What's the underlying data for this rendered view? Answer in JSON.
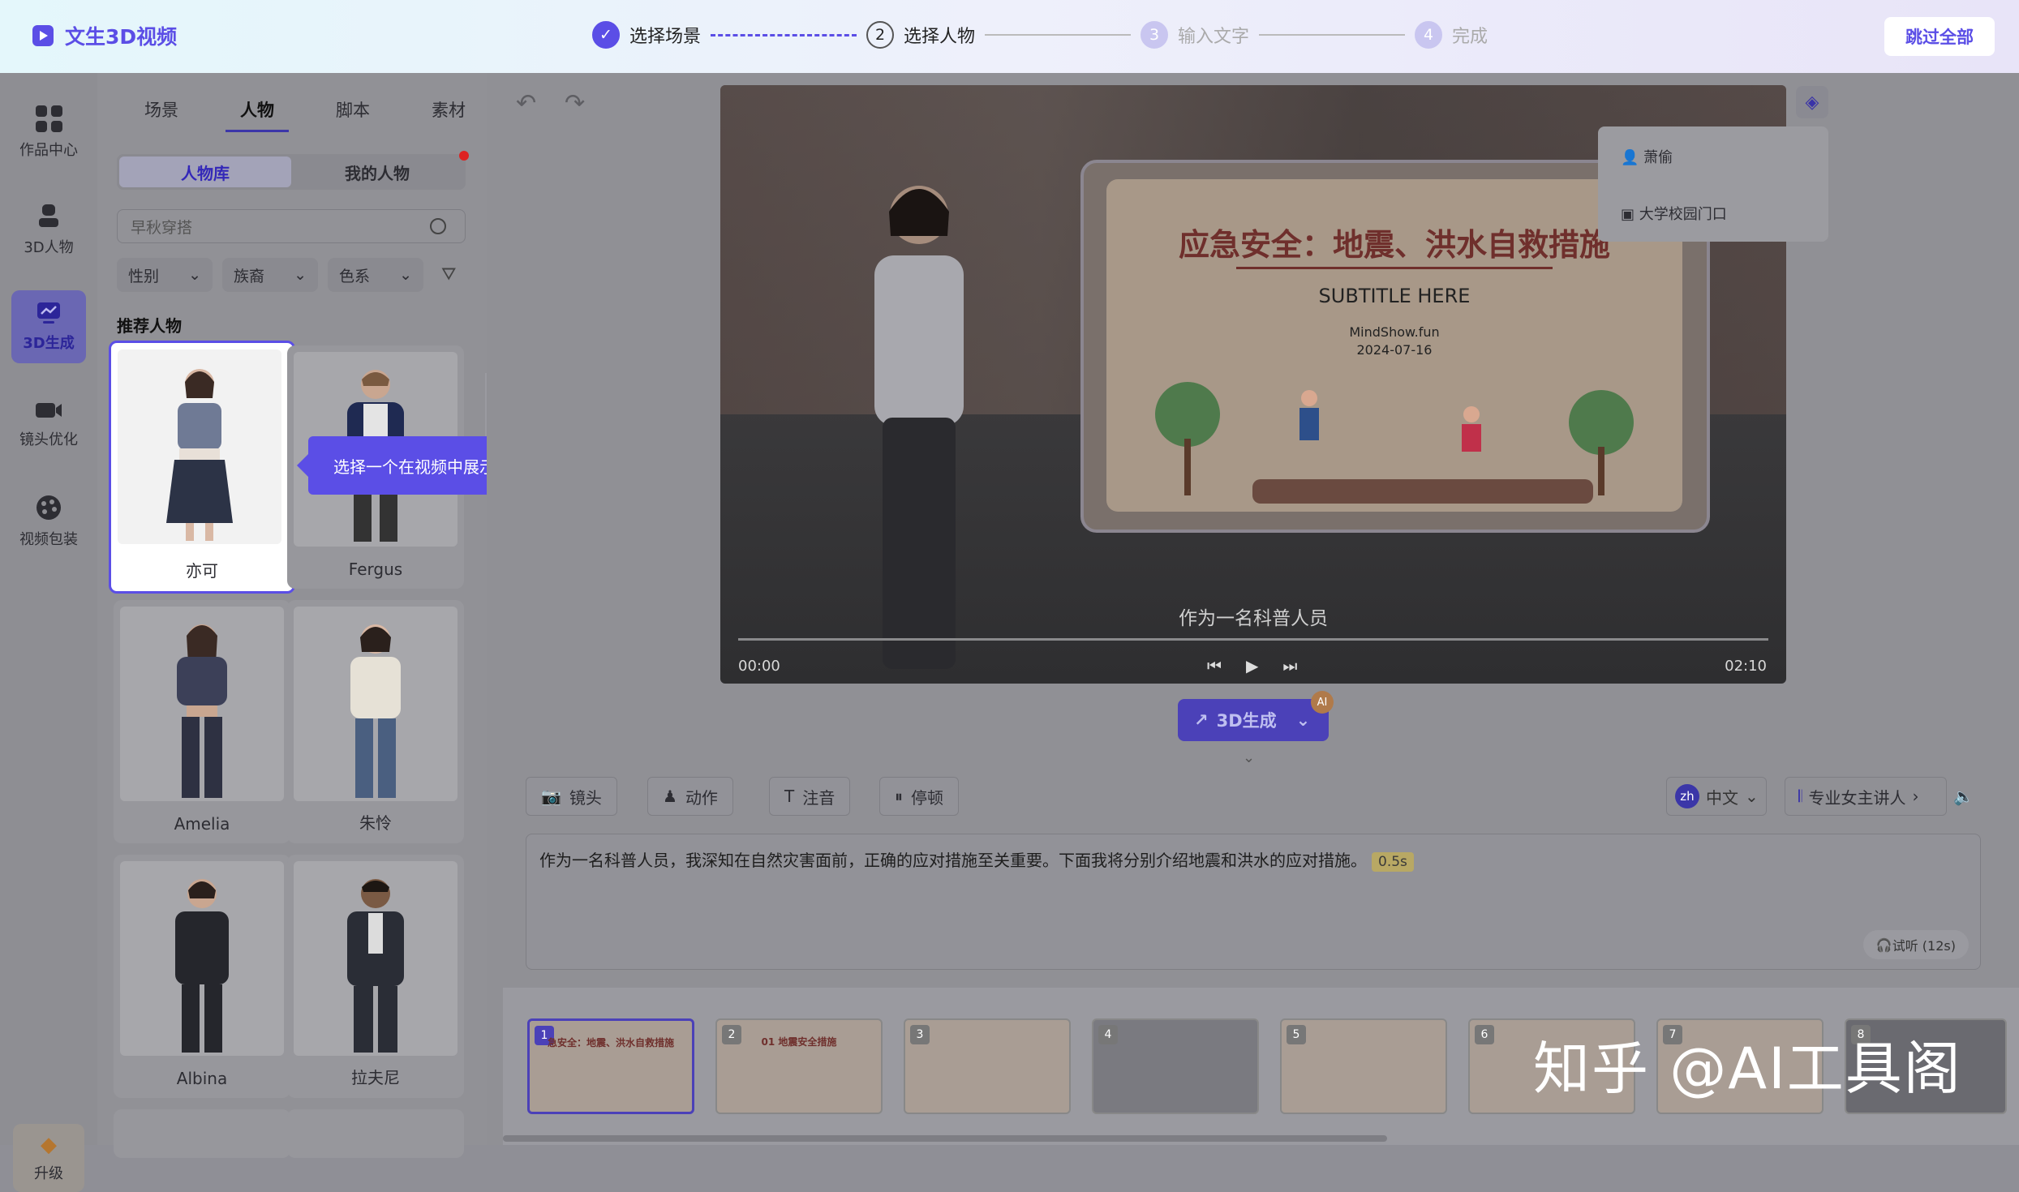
{
  "app": {
    "title": "文生3D视频"
  },
  "steps": [
    {
      "num": "",
      "label": "选择场景",
      "state": "done"
    },
    {
      "num": "2",
      "label": "选择人物",
      "state": "current"
    },
    {
      "num": "3",
      "label": "输入文字",
      "state": "todo"
    },
    {
      "num": "4",
      "label": "完成",
      "state": "todo"
    }
  ],
  "skip_all": "跳过全部",
  "rail": {
    "items": [
      {
        "label": "作品中心",
        "icon": "grid-icon"
      },
      {
        "label": "3D人物",
        "icon": "person-icon"
      },
      {
        "label": "3D生成",
        "icon": "chart-icon"
      },
      {
        "label": "镜头优化",
        "icon": "camera-icon"
      },
      {
        "label": "视频包装",
        "icon": "palette-icon"
      }
    ],
    "upgrade": "升级"
  },
  "panel": {
    "tabs": [
      "场景",
      "人物",
      "脚本",
      "素材"
    ],
    "segments": [
      "人物库",
      "我的人物"
    ],
    "search_placeholder": "早秋穿搭",
    "filters": [
      "性别",
      "族裔",
      "色系"
    ],
    "section_title": "推荐人物",
    "characters": [
      {
        "name": "亦可"
      },
      {
        "name": "Fergus"
      },
      {
        "name": "Amelia"
      },
      {
        "name": "朱怜"
      },
      {
        "name": "Albina"
      },
      {
        "name": "拉夫尼"
      }
    ],
    "tooltip": "选择一个在视频中展示的人物"
  },
  "player": {
    "slide_title": "应急安全：地震、洪水自救措施",
    "slide_subtitle": "SUBTITLE HERE",
    "slide_meta_1": "MindShow.fun",
    "slide_meta_2": "2024-07-16",
    "caption": "作为一名科普人员",
    "time_current": "00:00",
    "time_total": "02:10",
    "layers_menu": [
      "萧偷",
      "大学校园门口"
    ]
  },
  "generate": {
    "label": "3D生成",
    "badge": "AI"
  },
  "editor": {
    "tools": [
      "镜头",
      "动作",
      "注音",
      "停顿"
    ],
    "language": {
      "code": "zh",
      "label": "中文"
    },
    "voice": "专业女主讲人",
    "script_text": "作为一名科普人员，我深知在自然灾害面前，正确的应对措施至关重要。下面我将分别介绍地震和洪水的应对措施。",
    "pause_tag": "0.5s",
    "listen": "试听 (12s)"
  },
  "thumbnails": [
    {
      "num": "1",
      "caption": "急安全：地震、洪水自救措施"
    },
    {
      "num": "2",
      "caption": "01 地震安全措施"
    },
    {
      "num": "3",
      "caption": ""
    },
    {
      "num": "4",
      "caption": ""
    },
    {
      "num": "5",
      "caption": ""
    },
    {
      "num": "6",
      "caption": ""
    },
    {
      "num": "7",
      "caption": ""
    },
    {
      "num": "8",
      "caption": ""
    }
  ],
  "watermark": "知乎 @AI工具阁",
  "colors": {
    "accent": "#5b4ee6",
    "accent_dark": "#4b41b8",
    "overlay": "#909095"
  }
}
